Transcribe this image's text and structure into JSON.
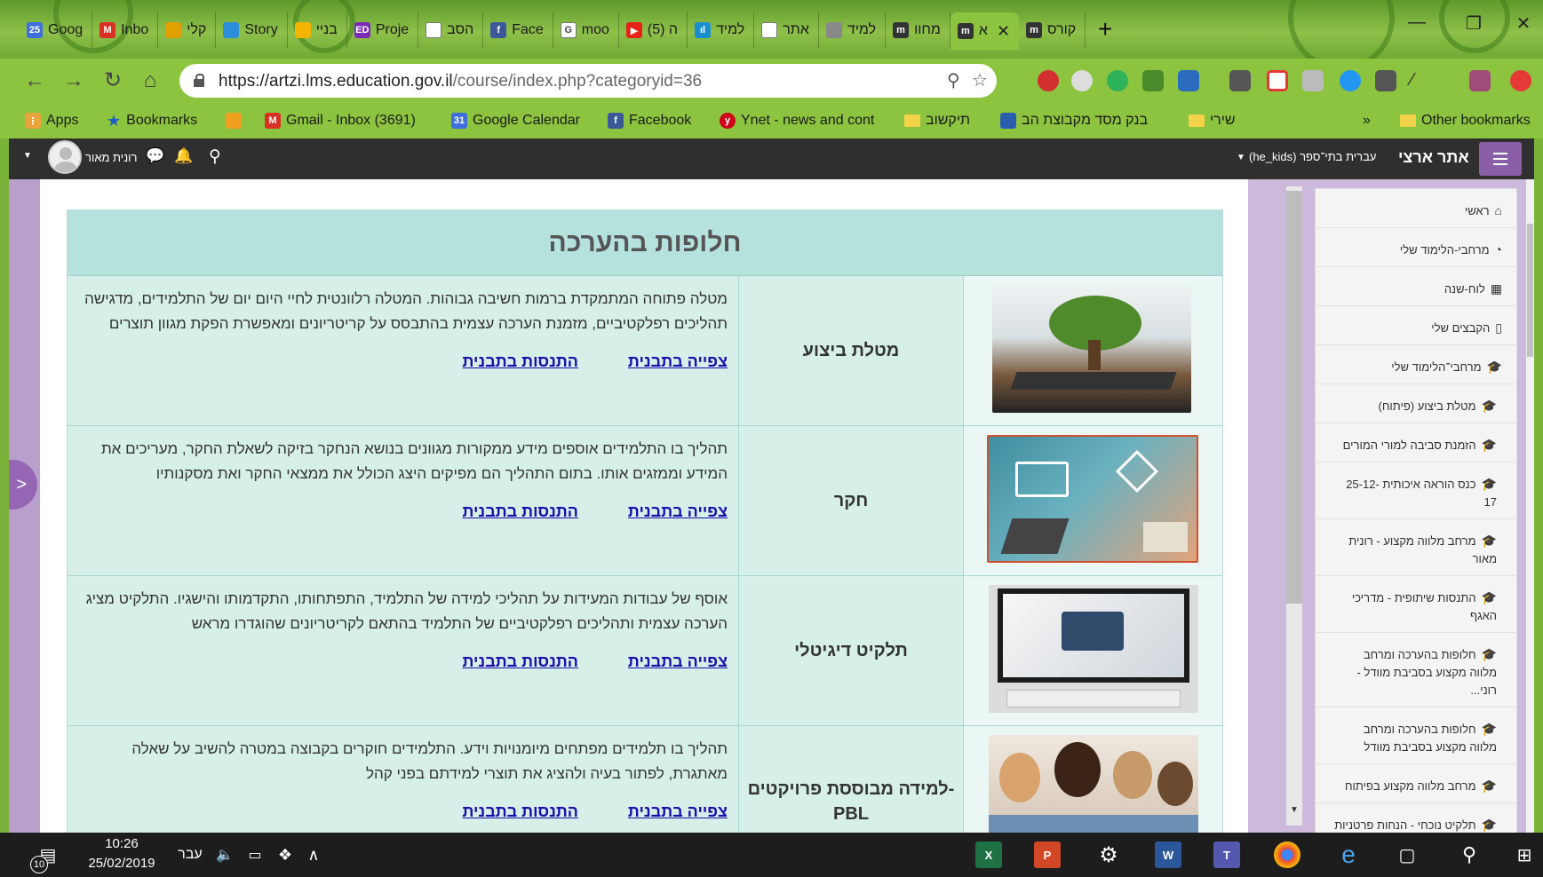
{
  "browser": {
    "tabs": [
      {
        "title": "Goog",
        "icon": "calendar-icon",
        "color": "#3f6fdc",
        "badge": "25"
      },
      {
        "title": "Inbo",
        "icon": "gmail-icon",
        "color": "#d93025",
        "badge": "M"
      },
      {
        "title": "קלי",
        "icon": "image-icon",
        "color": "#e2a000",
        "badge": ""
      },
      {
        "title": "Story",
        "icon": "shirt-icon",
        "color": "#2c8dd8",
        "badge": ""
      },
      {
        "title": "בניי",
        "icon": "slides-icon",
        "color": "#f5b400",
        "badge": ""
      },
      {
        "title": "Proje",
        "icon": "ed-icon",
        "color": "#7a2cb5",
        "badge": "ED"
      },
      {
        "title": "הסב",
        "icon": "page-icon",
        "color": "#ffffff",
        "badge": ""
      },
      {
        "title": "Face",
        "icon": "facebook-icon",
        "color": "#3b5998",
        "badge": "f"
      },
      {
        "title": "moo",
        "icon": "google-icon",
        "color": "#ffffff",
        "badge": "G"
      },
      {
        "title": "(5) ה",
        "icon": "youtube-icon",
        "color": "#e62117",
        "badge": "▶"
      },
      {
        "title": "למיד",
        "icon": "stats-icon",
        "color": "#1a8fd0",
        "badge": "ıl"
      },
      {
        "title": "אתר",
        "icon": "page-icon",
        "color": "#ffffff",
        "badge": ""
      },
      {
        "title": "למיד",
        "icon": "owl-icon",
        "color": "#888888",
        "badge": ""
      },
      {
        "title": "מחוו",
        "icon": "moodle-icon",
        "color": "#333333",
        "badge": "m"
      },
      {
        "title": "א",
        "icon": "moodle-icon",
        "color": "#333333",
        "badge": "m",
        "active": true
      },
      {
        "title": "קורס",
        "icon": "moodle-icon",
        "color": "#333333",
        "badge": "m"
      }
    ],
    "url_host": "https://artzi.lms.education.gov.il",
    "url_path": "/course/index.php?categoryid=36",
    "bookmarks": [
      {
        "label": "Apps",
        "icon": "apps-icon"
      },
      {
        "label": "Bookmarks",
        "icon": "star-icon"
      },
      {
        "label": "",
        "icon": "goo-icon"
      },
      {
        "label": "Gmail - Inbox (3691)",
        "icon": "gmail-icon"
      },
      {
        "label": "Google Calendar",
        "icon": "calendar-icon"
      },
      {
        "label": "Facebook",
        "icon": "facebook-icon"
      },
      {
        "label": "Ynet - news and cont",
        "icon": "ynet-icon"
      },
      {
        "label": "תיקשוב",
        "icon": "folder-icon"
      },
      {
        "label": "בנק מסד מקבוצת הב",
        "icon": "bank-icon"
      },
      {
        "label": "שירי",
        "icon": "folder-icon"
      },
      {
        "label": "»",
        "icon": ""
      },
      {
        "label": "Other bookmarks",
        "icon": "folder-icon"
      }
    ]
  },
  "navbar": {
    "site_name": "אתר ארצי",
    "language": "(he_kids) עברית בתי־ספר",
    "user_name": "רונית מאור"
  },
  "main": {
    "card_title": "חלופות בהערכה",
    "view_link": "צפייה בתבנית",
    "try_link": "התנסות בתבנית",
    "rows": [
      {
        "name": "מטלת ביצוע",
        "description": "מטלה פתוחה המתמקדת ברמות חשיבה גבוהות. המטלה רלוונטית לחיי היום יום של התלמידים, מדגישה תהליכים רפלקטיביים, מזמנת הערכה עצמית בהתבסס על קריטריונים ומאפשרת הפקת מגוון תוצרים",
        "image": "tree-on-tablet-image"
      },
      {
        "name": "חקר",
        "description": "תהליך בו התלמידים אוספים מידע ממקורות מגוונים בנושא הנחקר בזיקה לשאלת החקר, מעריכים את המידע וממזגים אותו. בתום התהליך הם מפיקים היצג הכולל את ממצאי החקר ואת מסקנותיו",
        "image": "research-collage-image"
      },
      {
        "name": "תלקיט דיגיטלי",
        "description": "אוסף של עבודות המעידות על תהליכי למידה של התלמיד, התפתחותו, התקדמותו והישגיו. התלקיט מציג הערכה עצמית ותהליכים רפלקטיביים של התלמיד בהתאם לקריטריונים שהוגדרו מראש",
        "image": "digital-portfolio-image"
      },
      {
        "name": "למידה מבוססת פרויקטים- PBL",
        "description": "תהליך בו תלמידים מפתחים מיומנויות וידע. התלמידים חוקרים בקבוצה במטרה להשיב על שאלה מאתגרת, לפתור בעיה ולהציג את תוצרי למידתם בפני קהל",
        "image": "students-group-image"
      }
    ]
  },
  "sidebar": {
    "items": [
      {
        "label": "ראשי",
        "icon": "home-icon"
      },
      {
        "label": "מרחבי-הלימוד שלי",
        "icon": "dashboard-icon"
      },
      {
        "label": "לוח-שנה",
        "icon": "calendar-icon"
      },
      {
        "label": "הקבצים שלי",
        "icon": "file-icon"
      },
      {
        "label": "מרחבי־הלימוד שלי",
        "icon": "graduation-cap-icon"
      },
      {
        "label": "מטלת ביצוע (פיתוח)",
        "icon": "graduation-cap-icon"
      },
      {
        "label": "הזמנת סביבה למורי המורים",
        "icon": "graduation-cap-icon"
      },
      {
        "label": "כנס הוראה איכותית -25-12 17",
        "icon": "graduation-cap-icon"
      },
      {
        "label": "מרחב מלווה מקצוע - רונית מאור",
        "icon": "graduation-cap-icon"
      },
      {
        "label": "התנסות שיתופית - מדריכי האגף",
        "icon": "graduation-cap-icon"
      },
      {
        "label": "חלופות בהערכה ומרחב מלווה מקצוע בסביבת מוודל -רוני...",
        "icon": "graduation-cap-icon"
      },
      {
        "label": "חלופות בהערכה ומרחב מלווה מקצוע בסביבת מוודל",
        "icon": "graduation-cap-icon"
      },
      {
        "label": "מרחב מלווה מקצוע בפיתוח",
        "icon": "graduation-cap-icon"
      },
      {
        "label": "תלקיט נוכחי - הנחות פרטניות",
        "icon": "graduation-cap-icon"
      }
    ]
  },
  "taskbar": {
    "time": "10:26",
    "date": "25/02/2019",
    "language": "עבר",
    "notification_count": "10"
  }
}
